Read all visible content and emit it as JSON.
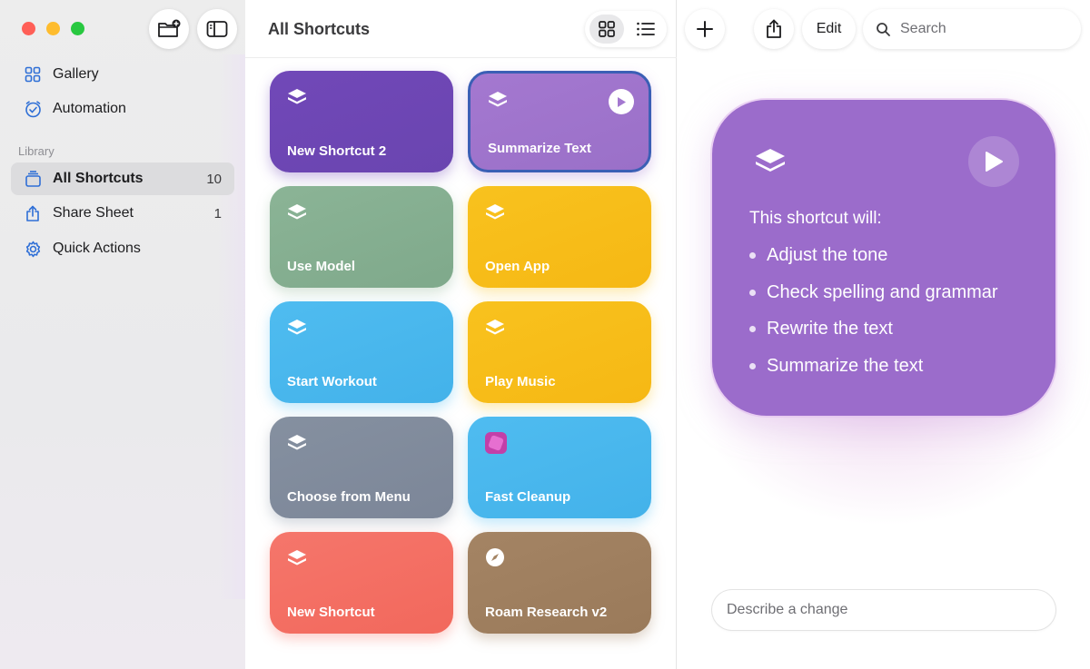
{
  "colors": {
    "purple_dark": "#7148b8",
    "purple_light": "#a478d0",
    "green": "#8bb496",
    "yellow": "#f8c21e",
    "blue": "#4fbcf0",
    "gray": "#8590a0",
    "coral": "#f5766b",
    "brown": "#a48464",
    "card_purple": "#9b6ccb",
    "selection": "#3b5fb5"
  },
  "sidebar": {
    "section_label": "Library",
    "top_items": [
      {
        "label": "Gallery",
        "icon": "gallery-grid-icon"
      },
      {
        "label": "Automation",
        "icon": "automation-clock-icon"
      }
    ],
    "library_items": [
      {
        "label": "All Shortcuts",
        "count": "10",
        "icon": "stack-icon",
        "active": true
      },
      {
        "label": "Share Sheet",
        "count": "1",
        "icon": "share-icon"
      },
      {
        "label": "Quick Actions",
        "count": "",
        "icon": "gear-icon"
      }
    ]
  },
  "middle": {
    "title": "All Shortcuts",
    "tiles": [
      {
        "label": "New Shortcut 2",
        "icon": "layers-icon"
      },
      {
        "label": "Summarize Text",
        "icon": "layers-icon",
        "selected": true
      },
      {
        "label": "Use Model",
        "icon": "layers-icon"
      },
      {
        "label": "Open App",
        "icon": "layers-icon"
      },
      {
        "label": "Start Workout",
        "icon": "layers-icon"
      },
      {
        "label": "Play Music",
        "icon": "layers-icon"
      },
      {
        "label": "Choose from Menu",
        "icon": "layers-icon"
      },
      {
        "label": "Fast Cleanup",
        "icon": "app-icon"
      },
      {
        "label": "New Shortcut",
        "icon": "layers-icon"
      },
      {
        "label": "Roam Research v2",
        "icon": "compass-icon"
      }
    ]
  },
  "right": {
    "edit_label": "Edit",
    "search_placeholder": "Search",
    "card": {
      "heading": "This shortcut will:",
      "items": [
        "Adjust the tone",
        "Check spelling and grammar",
        "Rewrite the text",
        "Summarize the text"
      ]
    },
    "describe_placeholder": "Describe a change"
  }
}
